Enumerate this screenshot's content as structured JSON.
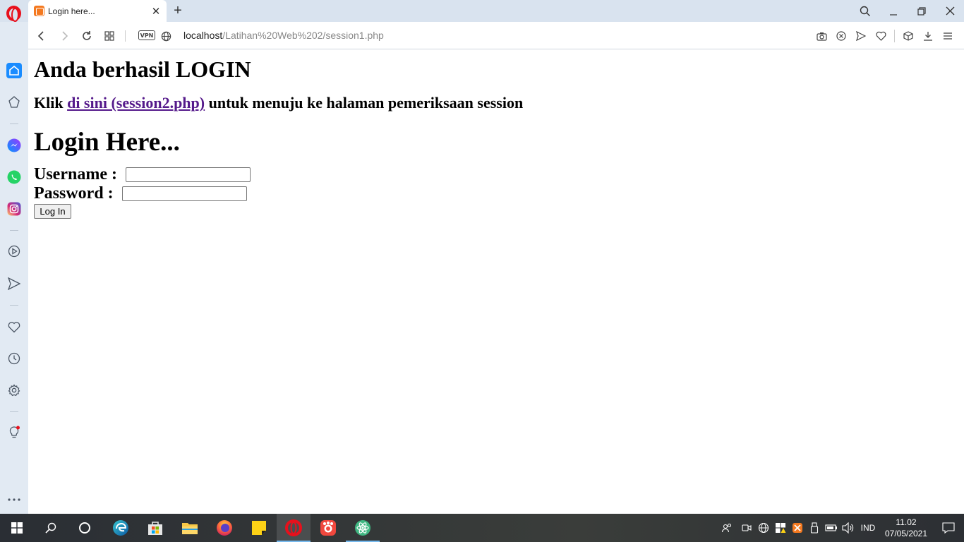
{
  "browser": {
    "tab": {
      "title": "Login here..."
    },
    "address": {
      "host": "localhost",
      "path": "/Latihan%20Web%202/session1.php"
    },
    "vpn_label": "VPN"
  },
  "page": {
    "heading_success": "Anda berhasil LOGIN",
    "info_prefix": "Klik ",
    "info_link": "di sini (session2.php)",
    "info_suffix": " untuk menuju ke halaman pemeriksaan session",
    "login_heading": "Login Here...",
    "username_label": "Username : ",
    "username_value": "",
    "password_label": "Password : ",
    "password_value": "",
    "login_button": "Log In"
  },
  "taskbar": {
    "clock_time": "11.02",
    "clock_date": "07/05/2021",
    "language": "IND"
  },
  "colors": {
    "link_visited": "#551a8b",
    "opera_red": "#e8101c",
    "sidebar_bg": "#e2eaf3",
    "taskbar_accent": "#76b9ed"
  }
}
